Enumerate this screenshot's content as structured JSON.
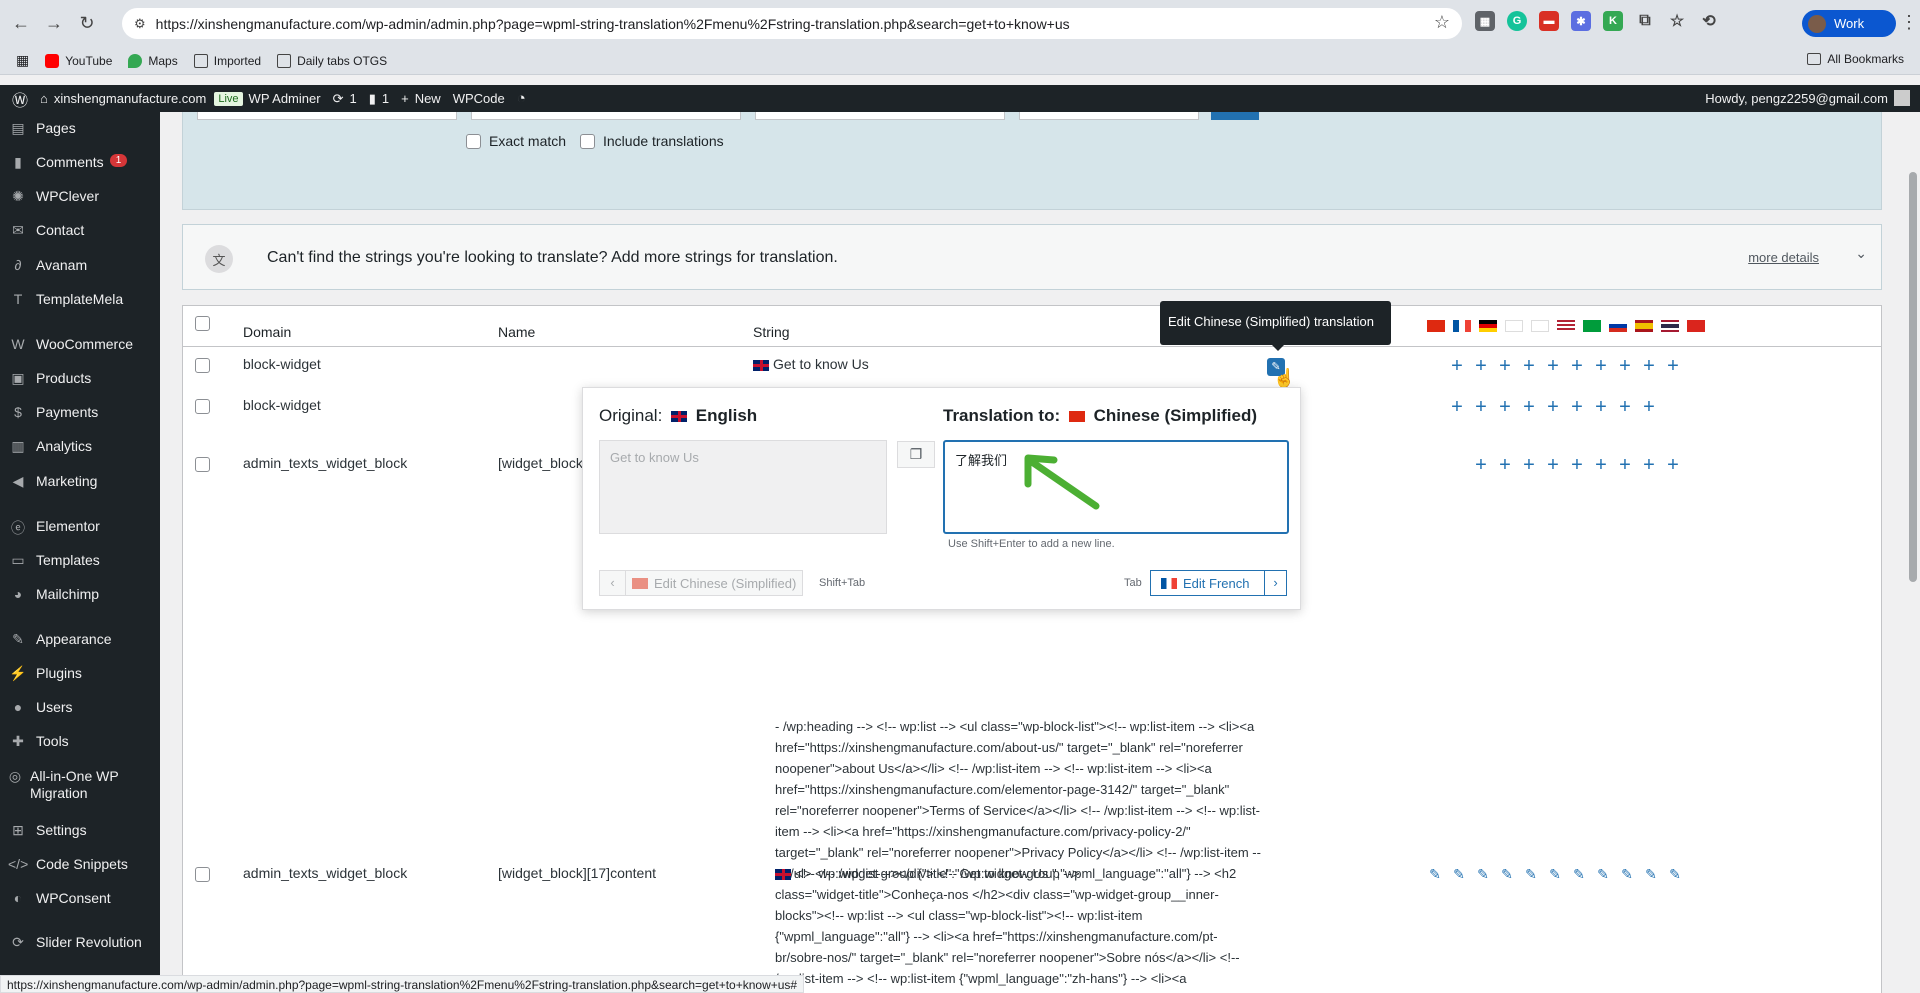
{
  "browser": {
    "url": "https://xinshengmanufacture.com/wp-admin/admin.php?page=wpml-string-translation%2Fmenu%2Fstring-translation.php&search=get+to+know+us",
    "profile_label": "Work",
    "bookmarks": [
      "YouTube",
      "Maps",
      "Imported",
      "Daily tabs OTGS"
    ],
    "all_bookmarks": "All Bookmarks",
    "status_url": "https://xinshengmanufacture.com/wp-admin/admin.php?page=wpml-string-translation%2Fmenu%2Fstring-translation.php&search=get+to+know+us#"
  },
  "adminbar": {
    "site": "xinshengmanufacture.com",
    "live": "Live",
    "adminer": "WP Adminer",
    "updates": "1",
    "comments": "1",
    "new": "New",
    "wpcode": "WPCode",
    "howdy": "Howdy, pengz2259@gmail.com"
  },
  "sidebar": {
    "items": [
      {
        "label": "Pages",
        "icon": "pages-icon"
      },
      {
        "label": "Comments",
        "icon": "comments-icon",
        "badge": "1"
      },
      {
        "label": "WPClever",
        "icon": "wpclever-icon"
      },
      {
        "label": "Contact",
        "icon": "mail-icon"
      },
      {
        "label": "Avanam",
        "icon": "avanam-icon"
      },
      {
        "label": "TemplateMela",
        "icon": "templatemela-icon"
      },
      {
        "label": "WooCommerce",
        "icon": "woocommerce-icon"
      },
      {
        "label": "Products",
        "icon": "products-icon"
      },
      {
        "label": "Payments",
        "icon": "payments-icon"
      },
      {
        "label": "Analytics",
        "icon": "analytics-icon"
      },
      {
        "label": "Marketing",
        "icon": "marketing-icon"
      },
      {
        "label": "Elementor",
        "icon": "elementor-icon"
      },
      {
        "label": "Templates",
        "icon": "templates-icon"
      },
      {
        "label": "Mailchimp",
        "icon": "mailchimp-icon"
      },
      {
        "label": "Appearance",
        "icon": "appearance-icon"
      },
      {
        "label": "Plugins",
        "icon": "plugins-icon"
      },
      {
        "label": "Users",
        "icon": "users-icon"
      },
      {
        "label": "Tools",
        "icon": "tools-icon"
      },
      {
        "label": "All-in-One WP Migration",
        "icon": "migration-icon"
      },
      {
        "label": "Settings",
        "icon": "settings-icon"
      },
      {
        "label": "Code Snippets",
        "icon": "code-icon"
      },
      {
        "label": "WPConsent",
        "icon": "consent-icon"
      },
      {
        "label": "Slider Revolution",
        "icon": "slider-icon"
      }
    ]
  },
  "filters": {
    "exact_match": "Exact match",
    "include_translations": "Include translations"
  },
  "notice": {
    "text": "Can't find the strings you're looking to translate? Add more strings for translation.",
    "link": "more details"
  },
  "table": {
    "headers": {
      "domain": "Domain",
      "name": "Name",
      "string": "String"
    },
    "rows": [
      {
        "domain": "block-widget",
        "name": "",
        "string": "Get to know Us"
      },
      {
        "domain": "block-widget",
        "name": "",
        "string": ""
      },
      {
        "domain": "admin_texts_widget_block",
        "name": "[widget_block",
        "string": ""
      },
      {
        "domain": "admin_texts_widget_block",
        "name": "[widget_block][17]content",
        "string": ""
      }
    ],
    "row3_text": "- /wp:heading --> <!-- wp:list --> <ul class=\"wp-block-list\"><!-- wp:list-item --> <li><a href=\"https://xinshengmanufacture.com/about-us/\" target=\"_blank\" rel=\"noreferrer noopener\">about Us</a></li> <!-- /wp:list-item --> <!-- wp:list-item --> <li><a href=\"https://xinshengmanufacture.com/elementor-page-3142/\" target=\"_blank\" rel=\"noreferrer noopener\">Terms of Service</a></li> <!-- /wp:list-item --> <!-- wp:list-item --> <li><a href=\"https://xinshengmanufacture.com/privacy-policy-2/\" target=\"_blank\" rel=\"noreferrer noopener\">Privacy Policy</a></li> <!-- /wp:list-item --></ul> <!-- /wp:list --></div> <!-- /wp:widget-group -->",
    "row4_text": "<!-- wp:widget-group {\"title\":\"Get to know Us \",\"wpml_language\":\"all\"} --> <h2 class=\"widget-title\">Conheça-nos </h2><div class=\"wp-widget-group__inner-blocks\"><!-- wp:list --> <ul class=\"wp-block-list\"><!-- wp:list-item {\"wpml_language\":\"all\"} --> <li><a href=\"https://xinshengmanufacture.com/pt-br/sobre-nos/\" target=\"_blank\" rel=\"noreferrer noopener\">Sobre nós</a></li> <!-- /wp:list-item --> <!-- wp:list-item {\"wpml_language\":\"zh-hans\"} --> <li><a href=\"https://xinshengmanufacture.com/pt-br/termos-de-servico/\" target=\"_blank\" rel=\"noreferrer noopener\">Termos de serviço</a></li> <!--"
  },
  "tooltip": "Edit Chinese (Simplified) translation",
  "popup": {
    "original_label": "Original:",
    "original_lang": "English",
    "translation_label": "Translation to:",
    "translation_lang": "Chinese (Simplified)",
    "original_value": "Get to know Us",
    "translation_value": "了解我们",
    "hint": "Use Shift+Enter to add a new line.",
    "prev_label": "Edit Chinese (Simplified)",
    "shift_tab": "Shift+Tab",
    "tab": "Tab",
    "next_label": "Edit French"
  },
  "colors": {
    "wp_blue": "#2271b1",
    "admin_dark": "#1d2327",
    "annotation_green": "#4caf33"
  }
}
